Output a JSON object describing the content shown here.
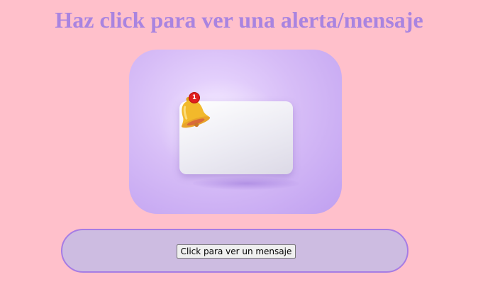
{
  "page": {
    "title": "Haz click para ver una alerta/mensaje"
  },
  "hero": {
    "badge_count": "1",
    "icons": [
      "bell-icon",
      "message-card-icon"
    ]
  },
  "action": {
    "button_label": "Click para ver un mensaje"
  },
  "colors": {
    "background": "#ffc0cb",
    "title": "#a984e0",
    "panel_fill": "#cdbce1",
    "panel_border": "#a67ce4",
    "badge": "#e01e1e",
    "bell": "#f2b92b"
  }
}
